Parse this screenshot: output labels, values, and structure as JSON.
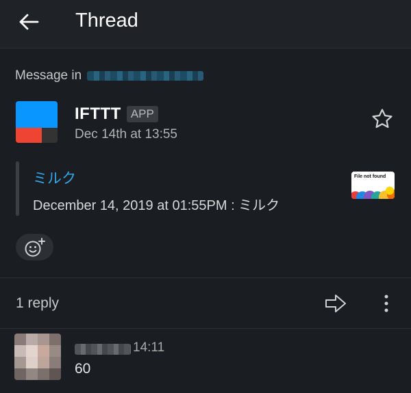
{
  "header": {
    "title": "Thread",
    "back_icon": "arrow-left-icon"
  },
  "context": {
    "prefix": "Message in"
  },
  "message": {
    "sender": "IFTTT",
    "badge": "APP",
    "timestamp": "Dec 14th at 13:55",
    "star_icon": "star-outline-icon",
    "logo_colors": {
      "top": "#0a96ff",
      "bottom_left": "#ee4433",
      "bottom_right": "#333333"
    },
    "attachment": {
      "title": "ミルク",
      "text": "December 14, 2019 at 01:55PM : ミルク",
      "thumbnail_label": "File not found"
    },
    "reaction_icon": "add-reaction-icon"
  },
  "replies": {
    "count_label": "1 reply",
    "forward_icon": "forward-arrow-icon",
    "more_icon": "more-vertical-icon",
    "items": [
      {
        "time": "14:11",
        "text": "60"
      }
    ]
  },
  "colors": {
    "background": "#1a1d21",
    "link": "#35a7e8"
  }
}
